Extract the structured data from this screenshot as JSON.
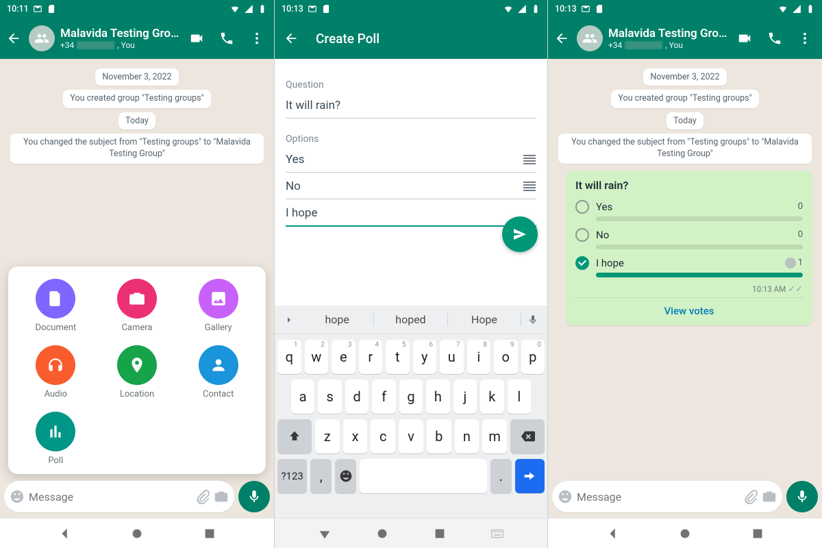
{
  "screen1": {
    "status": {
      "time": "10:11"
    },
    "header": {
      "title": "Malavida Testing Group",
      "subtitle_prefix": "+34",
      "subtitle_suffix": ", You"
    },
    "chips": {
      "date": "November 3, 2022",
      "created": "You created group \"Testing groups\"",
      "today": "Today",
      "subject_change": "You changed the subject from \"Testing groups\" to \"Malavida Testing Group\""
    },
    "attach": {
      "document": "Document",
      "camera": "Camera",
      "gallery": "Gallery",
      "audio": "Audio",
      "location": "Location",
      "contact": "Contact",
      "poll": "Poll"
    },
    "input": {
      "placeholder": "Message"
    }
  },
  "screen2": {
    "status": {
      "time": "10:13"
    },
    "header": {
      "title": "Create Poll"
    },
    "form": {
      "question_label": "Question",
      "question_value": "It will rain?",
      "options_label": "Options",
      "opt1": "Yes",
      "opt2": "No",
      "opt3": "I hope"
    },
    "suggestions": {
      "s1": "hope",
      "s2": "hoped",
      "s3": "Hope"
    },
    "keyboard": {
      "row1": [
        "q",
        "w",
        "e",
        "r",
        "t",
        "y",
        "u",
        "i",
        "o",
        "p"
      ],
      "row1_hints": [
        "1",
        "2",
        "3",
        "4",
        "5",
        "6",
        "7",
        "8",
        "9",
        "0"
      ],
      "row2": [
        "a",
        "s",
        "d",
        "f",
        "g",
        "h",
        "j",
        "k",
        "l"
      ],
      "row3": [
        "z",
        "x",
        "c",
        "v",
        "b",
        "n",
        "m"
      ],
      "sym": "?123",
      "comma": ",",
      "period": "."
    }
  },
  "screen3": {
    "status": {
      "time": "10:13"
    },
    "header": {
      "title": "Malavida Testing Group",
      "subtitle_prefix": "+34",
      "subtitle_suffix": ", You"
    },
    "chips": {
      "date": "November 3, 2022",
      "created": "You created group \"Testing groups\"",
      "today": "Today",
      "subject_change": "You changed the subject from \"Testing groups\" to \"Malavida Testing Group\""
    },
    "poll": {
      "question": "It will rain?",
      "opt1": {
        "label": "Yes",
        "count": "0"
      },
      "opt2": {
        "label": "No",
        "count": "0"
      },
      "opt3": {
        "label": "I hope",
        "count": "1"
      },
      "time": "10:13 AM",
      "view_votes": "View votes"
    },
    "input": {
      "placeholder": "Message"
    }
  }
}
